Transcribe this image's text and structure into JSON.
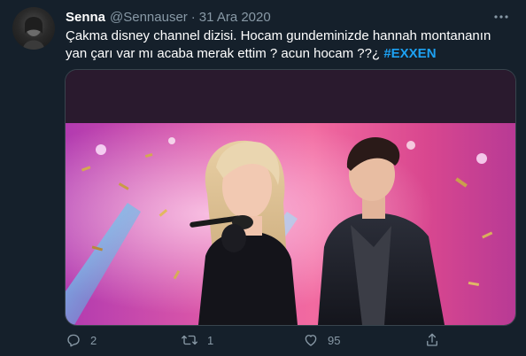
{
  "tweet": {
    "author_name": "Senna",
    "author_handle": "@Sennauser",
    "separator": "·",
    "date": "31 Ara 2020",
    "text_line1": "Çakma disney channel dizisi. Hocam gundeminizde hannah montananın",
    "text_line2": "yan çarı var mı acaba merak ettim ?  acun hocam ??¿ ",
    "hashtag": "#EXXEN",
    "more_icon": "more-horizontal-icon",
    "media_description_icon": "photo"
  },
  "actions": {
    "reply_count": "2",
    "retweet_count": "1",
    "like_count": "95",
    "reply_icon": "reply-icon",
    "retweet_icon": "retweet-icon",
    "like_icon": "heart-icon",
    "share_icon": "share-icon"
  },
  "colors": {
    "background": "#15202b",
    "text": "#ffffff",
    "secondary": "#8899a6",
    "accent": "#1da1f2",
    "border": "#38444d"
  }
}
